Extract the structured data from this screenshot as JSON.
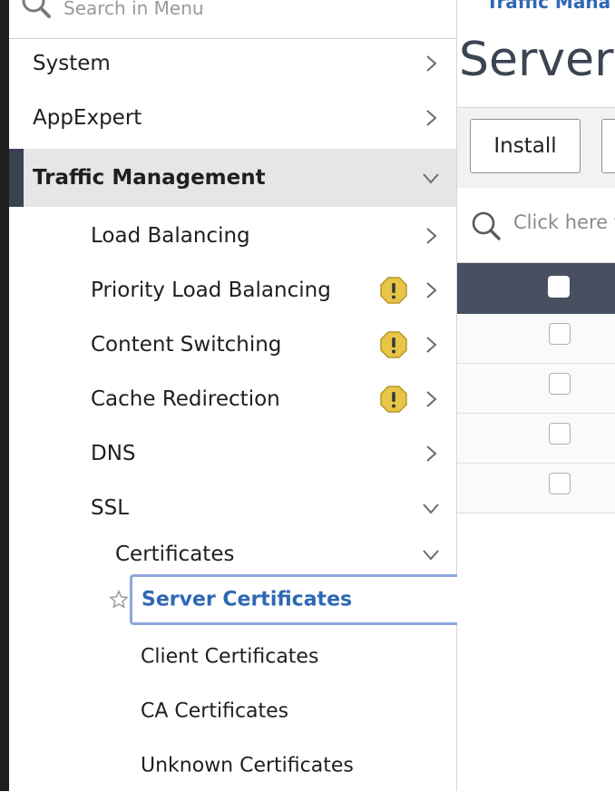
{
  "search": {
    "placeholder": "Search in Menu"
  },
  "sidebar": {
    "items": [
      {
        "label": "System"
      },
      {
        "label": "AppExpert"
      },
      {
        "label": "Traffic Management"
      }
    ],
    "traffic_management": {
      "items": [
        {
          "label": "Load Balancing",
          "warning": false
        },
        {
          "label": "Priority Load Balancing",
          "warning": true
        },
        {
          "label": "Content Switching",
          "warning": true
        },
        {
          "label": "Cache Redirection",
          "warning": true
        },
        {
          "label": "DNS",
          "warning": false
        },
        {
          "label": "SSL",
          "warning": false
        }
      ],
      "ssl": {
        "certificates": {
          "label": "Certificates",
          "items": [
            {
              "label": "Server Certificates",
              "selected": true
            },
            {
              "label": "Client Certificates"
            },
            {
              "label": "CA Certificates"
            },
            {
              "label": "Unknown Certificates"
            }
          ]
        }
      }
    }
  },
  "content": {
    "breadcrumb": "Traffic Mana",
    "page_title": "Server C",
    "toolbar": {
      "install_label": "Install"
    },
    "filter_placeholder": "Click here t"
  },
  "colors": {
    "accent": "#2f68b4",
    "active_bar": "#3a4150",
    "table_header": "#474f60",
    "warning": "#e8c547",
    "selected_border": "#8fa6de"
  },
  "icons": {
    "search": "search-icon",
    "chevron_right": "chevron-right-icon",
    "chevron_down": "chevron-down-icon",
    "warning": "warning-icon",
    "star": "star-icon"
  }
}
